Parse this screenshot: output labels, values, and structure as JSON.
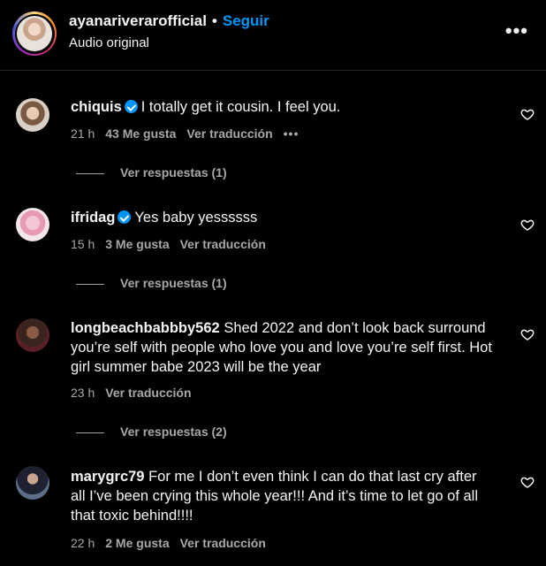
{
  "header": {
    "username": "ayanariverarofficial",
    "dot": "•",
    "follow_label": "Seguir",
    "subtitle": "Audio original",
    "more_label": "•••"
  },
  "comments": [
    {
      "username": "chiquis",
      "verified": true,
      "text": "I totally get it cousin. I feel you.",
      "time": "21 h",
      "likes": "43 Me gusta",
      "translate": "Ver traducción",
      "more": "•••",
      "replies": "Ver respuestas (1)"
    },
    {
      "username": "ifridag",
      "verified": true,
      "text": "Yes baby yessssss",
      "time": "15 h",
      "likes": "3 Me gusta",
      "translate": "Ver traducción",
      "replies": "Ver respuestas (1)"
    },
    {
      "username": "longbeachbabbby562",
      "verified": false,
      "text": "Shed 2022 and don’t look back surround you’re self with people who love you and love you’re self first. Hot girl summer babe 2023 will be the year",
      "time": "23 h",
      "translate": "Ver traducción",
      "replies": "Ver respuestas (2)"
    },
    {
      "username": "marygrc79",
      "verified": false,
      "text": "For me I don’t even think I can do that last cry after all I’ve been crying this whole year!!! And it’s time to let go of all that toxic behind!!!!",
      "time": "22 h",
      "likes": "2 Me gusta",
      "translate": "Ver traducción"
    }
  ],
  "colors": {
    "background": "#000000",
    "text": "#f5f5f5",
    "secondary": "#a8a8a8",
    "accent": "#0095f6"
  }
}
